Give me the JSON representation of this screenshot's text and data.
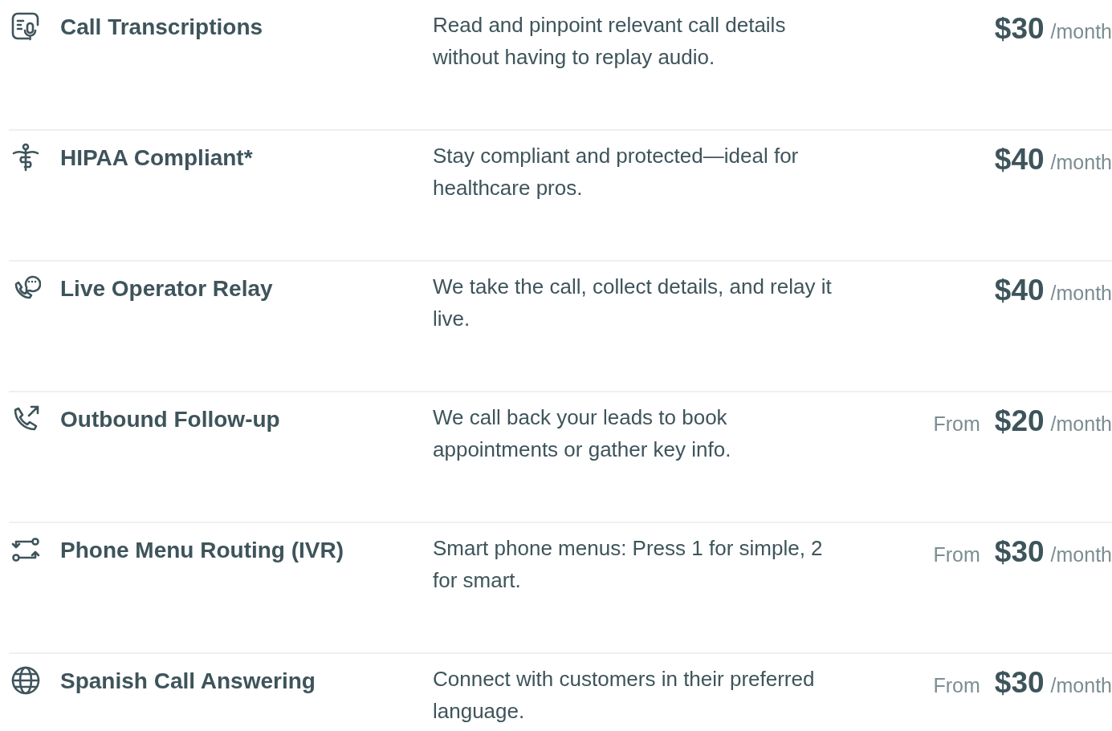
{
  "services": [
    {
      "title": "Call Transcriptions",
      "description": "Read and pinpoint relevant call details without having to replay audio.",
      "price": "$30",
      "period": "/month"
    },
    {
      "title": "HIPAA Compliant*",
      "description": "Stay compliant and protected—ideal for healthcare pros.",
      "price": "$40",
      "period": "/month"
    },
    {
      "title": "Live Operator Relay",
      "description": "We take the call, collect details, and relay it live.",
      "price": "$40",
      "period": "/month"
    },
    {
      "title": "Outbound Follow-up",
      "description": "We call back your leads to book appointments or gather key info.",
      "price_prefix": "From",
      "price": "$20",
      "period": "/month"
    },
    {
      "title": "Phone Menu Routing (IVR)",
      "description": "Smart phone menus: Press 1 for simple, 2 for smart.",
      "price_prefix": "From",
      "price": "$30",
      "period": "/month"
    },
    {
      "title": "Spanish Call Answering",
      "description": "Connect with customers in their preferred language.",
      "price_prefix": "From",
      "price": "$30",
      "period": "/month"
    }
  ]
}
